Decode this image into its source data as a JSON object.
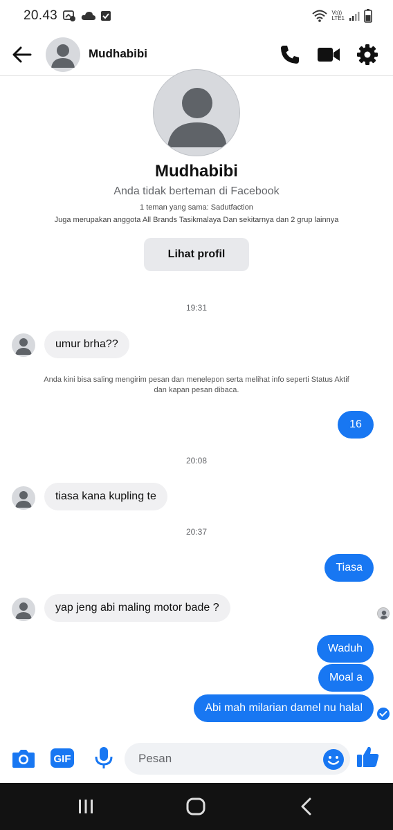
{
  "status_bar": {
    "time": "20.43",
    "network_label_top": "Vo))",
    "network_label_bottom": "LTE1"
  },
  "header": {
    "contact_name": "Mudhabibi"
  },
  "profile": {
    "name": "Mudhabibi",
    "friend_status": "Anda tidak berteman di Facebook",
    "mutual_friends": "1 teman yang sama: Sadutfaction",
    "groups": "Juga merupakan anggota All Brands Tasikmalaya Dan sekitarnya dan 2 grup lainnya",
    "view_profile_label": "Lihat profil"
  },
  "conversation": {
    "timestamps": [
      "19:31",
      "20:08",
      "20:37"
    ],
    "system_notice": "Anda kini bisa saling mengirim pesan dan menelepon serta melihat info seperti Status Aktif dan kapan pesan dibaca.",
    "messages": [
      {
        "from": "contact",
        "text": "umur brha??"
      },
      {
        "from": "me",
        "text": "16"
      },
      {
        "from": "contact",
        "text": "tiasa kana kupling te"
      },
      {
        "from": "me",
        "text": "Tiasa"
      },
      {
        "from": "contact",
        "text": "yap jeng abi maling motor bade ?"
      },
      {
        "from": "me",
        "text": "Waduh"
      },
      {
        "from": "me",
        "text": "Moal a"
      },
      {
        "from": "me",
        "text": "Abi mah milarian damel nu halal"
      }
    ]
  },
  "composer": {
    "placeholder": "Pesan",
    "gif_label": "GIF"
  },
  "colors": {
    "accent": "#1877f2",
    "incoming_bubble": "#f0f0f2",
    "navbar": "#121212"
  }
}
